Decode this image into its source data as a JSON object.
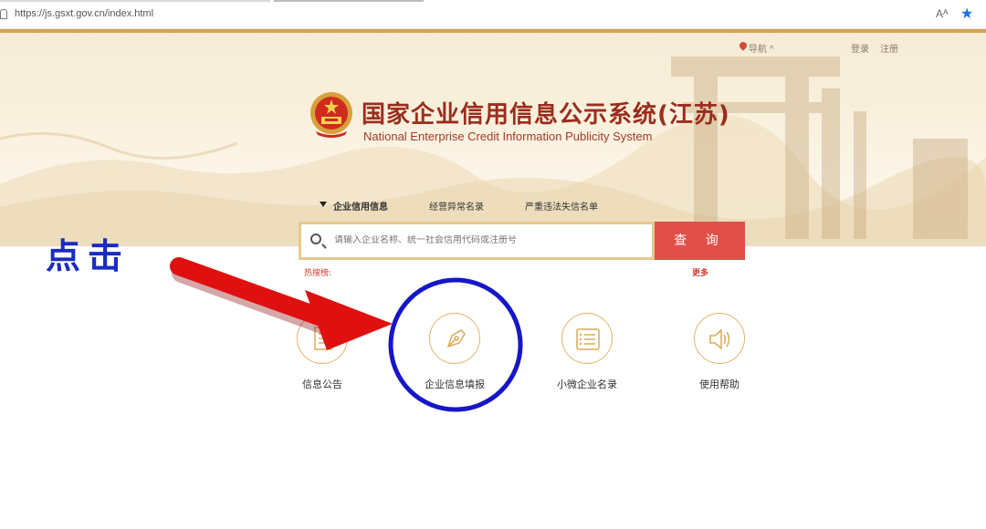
{
  "browser": {
    "url": "https://js.gsxt.gov.cn/index.html",
    "read_aloud_label": "Aᴬ",
    "favorite_icon": "star-icon"
  },
  "header_nav": {
    "nav_label": "导航 ^",
    "login": "登录",
    "register": "注册"
  },
  "site": {
    "title_cn": "国家企业信用信息公示系统(江苏)",
    "title_en": "National Enterprise Credit Information Publicity System",
    "emblem_icon": "national-emblem-icon"
  },
  "search": {
    "tabs": [
      {
        "label": "企业信用信息",
        "active": true
      },
      {
        "label": "经营异常名录",
        "active": false
      },
      {
        "label": "严重违法失信名单",
        "active": false
      }
    ],
    "placeholder": "请输入企业名称、统一社会信用代码或注册号",
    "button_label": "查 询",
    "hot_label": "热搜榜:",
    "more_label": "更多"
  },
  "features": [
    {
      "label": "信息公告",
      "icon": "document-icon"
    },
    {
      "label": "企业信息填报",
      "icon": "pen-nib-icon"
    },
    {
      "label": "小微企业名录",
      "icon": "list-icon"
    },
    {
      "label": "使用帮助",
      "icon": "speaker-icon"
    }
  ],
  "annotation": {
    "text": "点击",
    "colors": {
      "text": "#1a2cc0",
      "arrow": "#e01010",
      "circle": "#1616c8"
    }
  },
  "colors": {
    "title": "#9b2d1d",
    "search_button": "#e24f4a",
    "accent_gold": "#e0b569"
  }
}
